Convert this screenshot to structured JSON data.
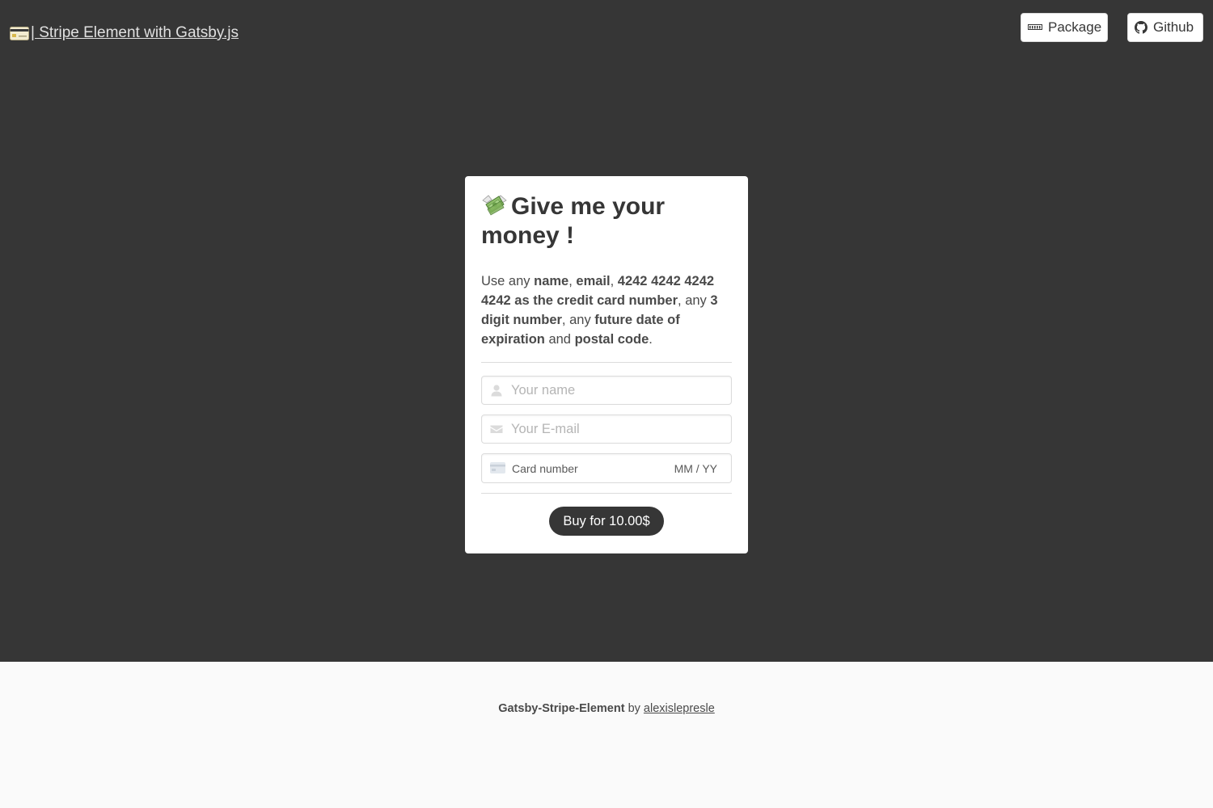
{
  "header": {
    "brand_label": "| Stripe Element with Gatsby.js",
    "brand_icon": "credit-card-emoji",
    "nav": {
      "package_label": "Package",
      "package_icon": "npm-icon",
      "github_label": "Github",
      "github_icon": "github-icon"
    }
  },
  "form": {
    "title": "Give me your money !",
    "title_icon": "money-with-wings-emoji",
    "instructions": {
      "t1": "Use any ",
      "b1": "name",
      "t2": ", ",
      "b2": "email",
      "t3": ", ",
      "b3": "4242 4242 4242 4242 as the credit card number",
      "t4": ", any ",
      "b4": "3 digit number",
      "t5": ", any ",
      "b5": "future date of expiration",
      "t6": " and ",
      "b6": "postal code",
      "t7": "."
    },
    "name_placeholder": "Your name",
    "email_placeholder": "Your E-mail",
    "card_placeholder": "Card number",
    "expiry_placeholder": "MM / YY",
    "buy_label": "Buy for 10.00$"
  },
  "footer": {
    "project": "Gatsby-Stripe-Element",
    "by": " by ",
    "author": "alexislepresle"
  },
  "colors": {
    "hero_bg": "#363636",
    "footer_bg": "#fafafa",
    "button_bg": "#363636"
  }
}
